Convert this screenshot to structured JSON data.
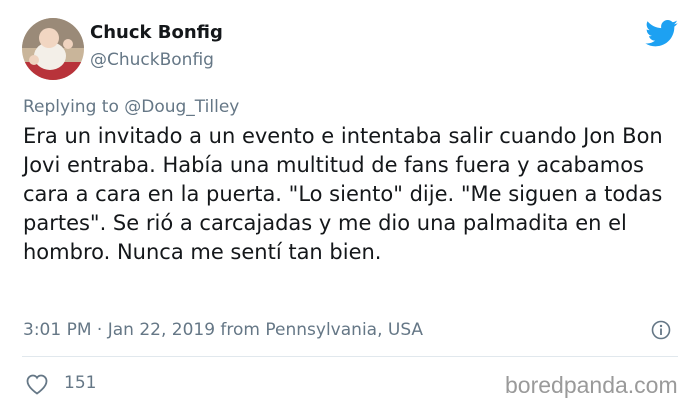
{
  "author": {
    "display_name": "Chuck Bonfig",
    "handle": "@ChuckBonfig",
    "avatar": "baby-photo-avatar"
  },
  "brand": {
    "icon": "twitter-bird-icon",
    "color": "#1da1f2"
  },
  "reply": {
    "prefix": "Replying to",
    "mention": "@Doug_Tilley"
  },
  "tweet": {
    "text": "Era un invitado a un evento e intentaba salir cuando Jon Bon Jovi entraba. Había una multitud de fans fuera y acabamos cara a cara en la puerta. \"Lo siento\" dije. \"Me siguen a todas partes\". Se rió a carcajadas y me dio una palmadita en el hombro. Nunca me sentí tan bien."
  },
  "meta": {
    "text": "3:01 PM · Jan 22, 2019 from Pennsylvania, USA"
  },
  "actions": {
    "likes": "151",
    "like_icon": "heart-icon",
    "info_icon": "info-icon"
  },
  "watermark": {
    "text": "boredpanda.com"
  }
}
